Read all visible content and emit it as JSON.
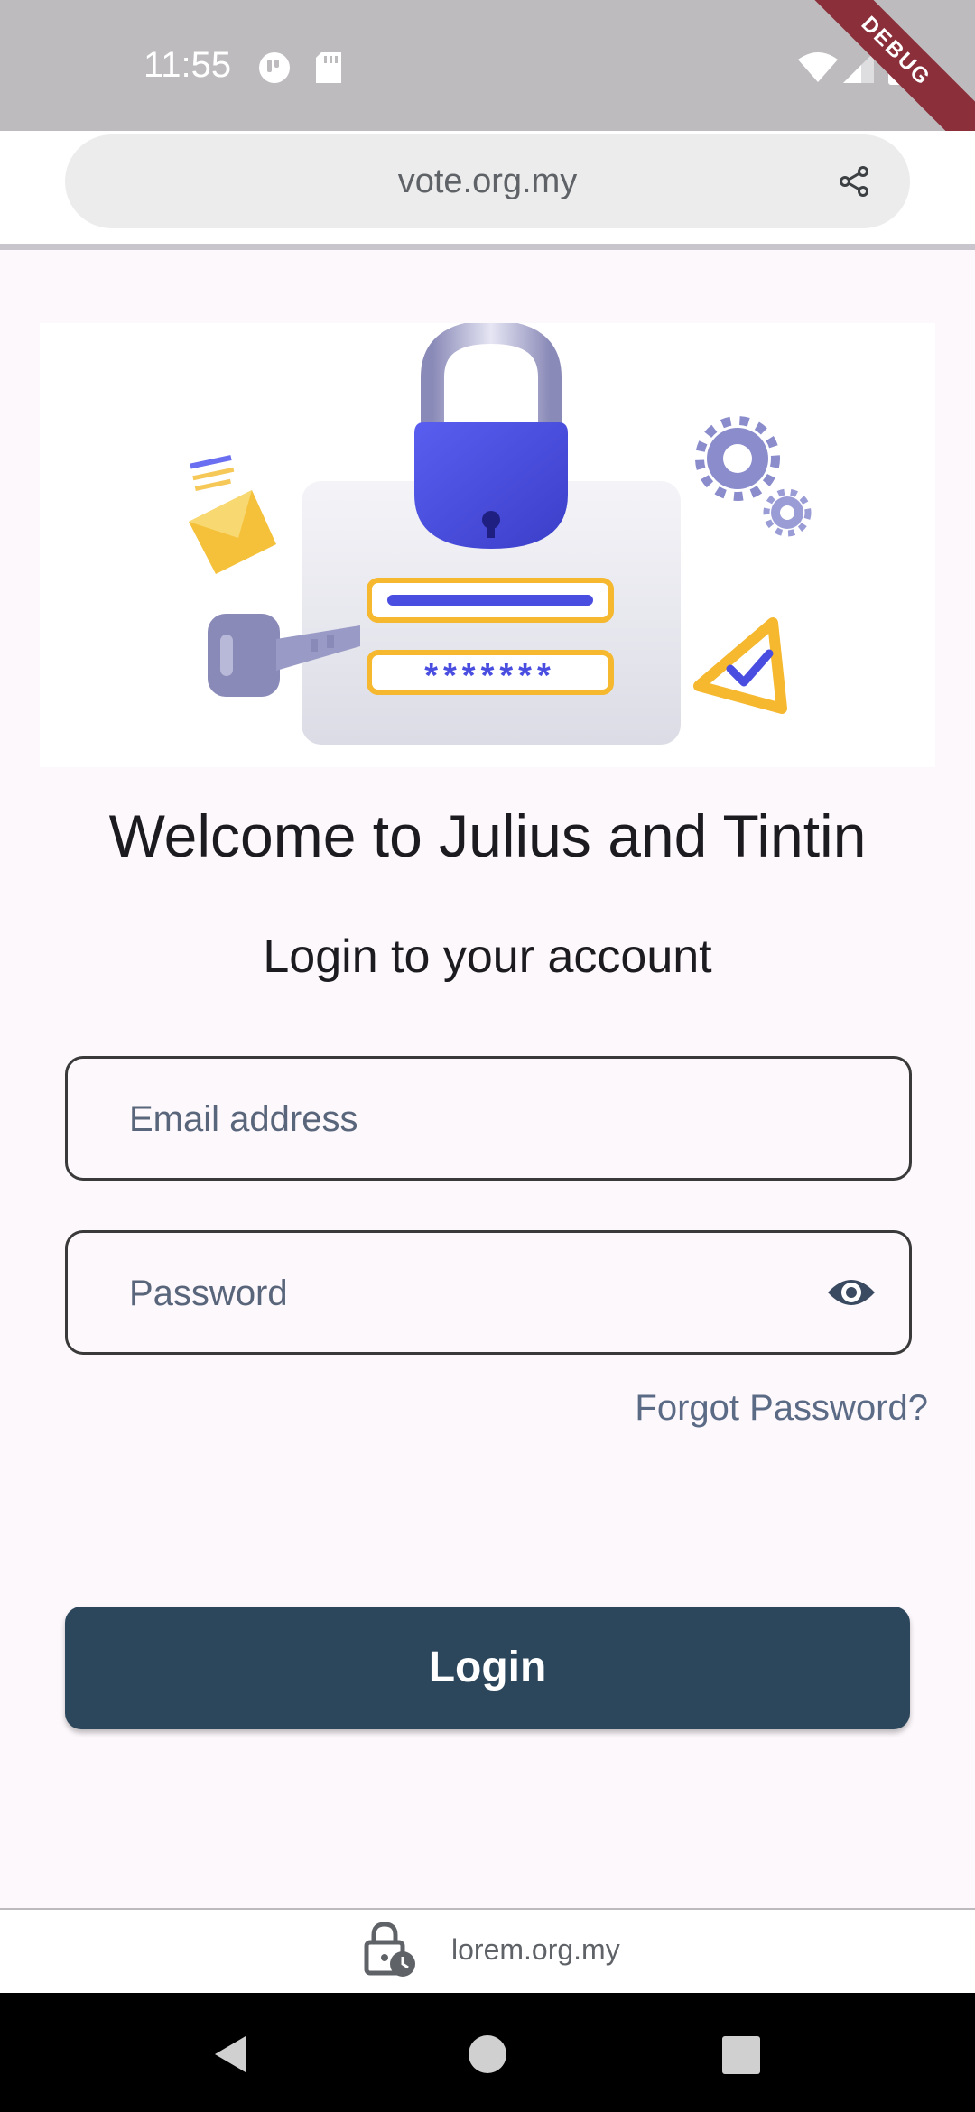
{
  "status_bar": {
    "time": "11:55",
    "debug_label": "DEBUG",
    "left_icons": [
      "app-notification-icon",
      "sd-card-icon"
    ],
    "right_icons": [
      "wifi-icon",
      "cellular-signal-icon",
      "battery-icon"
    ]
  },
  "browser": {
    "url": "vote.org.my",
    "share_icon": "share-icon"
  },
  "hero": {
    "icon": "login-security-illustration",
    "password_mask": "*******"
  },
  "page": {
    "title": "Welcome to Julius and Tintin",
    "subtitle": "Login to your account"
  },
  "form": {
    "email_placeholder": "Email address",
    "email_value": "",
    "password_placeholder": "Password",
    "password_value": "",
    "password_toggle_icon": "eye-icon",
    "forgot_label": "Forgot Password?",
    "login_label": "Login"
  },
  "footer": {
    "icon": "lock-clock-icon",
    "text": "lorem.org.my"
  },
  "nav": {
    "icons": [
      "back-icon",
      "home-icon",
      "recents-icon"
    ]
  },
  "colors": {
    "primary": "#2c475c",
    "link": "#5b6b86",
    "accent_blue": "#4a4ee0",
    "accent_yellow": "#f7c948",
    "background": "#fdf8fc"
  }
}
